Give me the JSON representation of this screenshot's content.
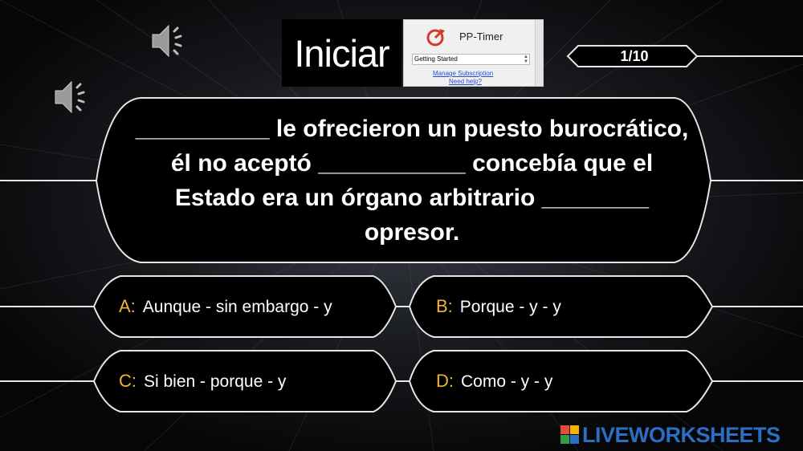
{
  "start_button": {
    "label": "Iniciar"
  },
  "pp_timer": {
    "title": "PP-Timer",
    "dropdown_value": "Getting Started",
    "manage_link": "Manage Subscription",
    "help_link": "Need help?"
  },
  "counter": {
    "text": "1/10"
  },
  "question": {
    "text": "__________ le ofrecieron un puesto burocrático, él no aceptó ___________ concebía que el Estado era un órgano arbitrario ________ opresor."
  },
  "answers": [
    {
      "letter": "A:",
      "text": "Aunque - sin embargo - y"
    },
    {
      "letter": "B:",
      "text": "Porque - y - y"
    },
    {
      "letter": "C:",
      "text": "Si bien - porque - y"
    },
    {
      "letter": "D:",
      "text": "Como - y - y"
    }
  ],
  "watermark": {
    "text": "LIVEWORKSHEETS"
  },
  "colors": {
    "accent": "#f3b431",
    "text": "#ffffff",
    "panel": "#000000",
    "border": "#e6e6e6",
    "logo": "#2a6fc4"
  },
  "icons": [
    "speaker-icon",
    "timer-icon"
  ]
}
